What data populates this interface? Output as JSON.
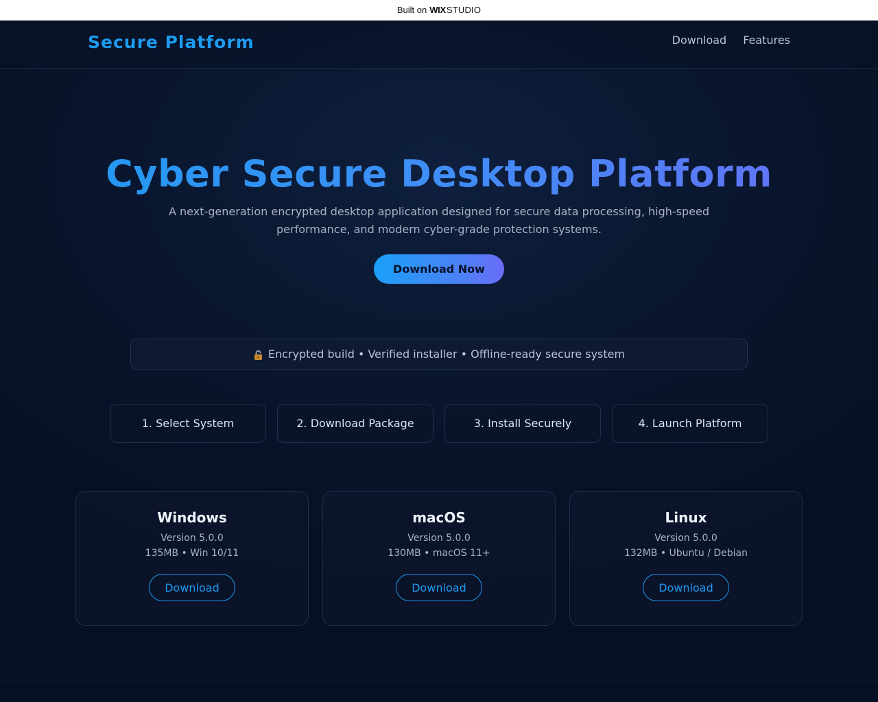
{
  "wix_bar": {
    "built": "Built on",
    "wix": "WIX",
    "studio": "STUDIO"
  },
  "header": {
    "logo": "Secure Platform",
    "nav": [
      {
        "label": "Download"
      },
      {
        "label": "Features"
      }
    ]
  },
  "hero": {
    "title": "Cyber Secure Desktop Platform",
    "subtitle": "A next-generation encrypted desktop application designed for secure data processing, high-speed performance, and modern cyber-grade protection systems.",
    "cta": "Download Now"
  },
  "trust": {
    "icon": "lock-icon",
    "text": "Encrypted build • Verified installer • Offline-ready secure system"
  },
  "steps": [
    {
      "label": "1. Select System"
    },
    {
      "label": "2. Download Package"
    },
    {
      "label": "3. Install Securely"
    },
    {
      "label": "4. Launch Platform"
    }
  ],
  "platforms": [
    {
      "name": "Windows",
      "version": "Version 5.0.0",
      "meta": "135MB • Win 10/11",
      "button": "Download"
    },
    {
      "name": "macOS",
      "version": "Version 5.0.0",
      "meta": "130MB • macOS 11+",
      "button": "Download"
    },
    {
      "name": "Linux",
      "version": "Version 5.0.0",
      "meta": "132MB • Ubuntu / Debian",
      "button": "Download"
    }
  ],
  "colors": {
    "accent": "#1e9bf0",
    "accent_purple": "#6a6cf5",
    "background": "#070f22"
  }
}
